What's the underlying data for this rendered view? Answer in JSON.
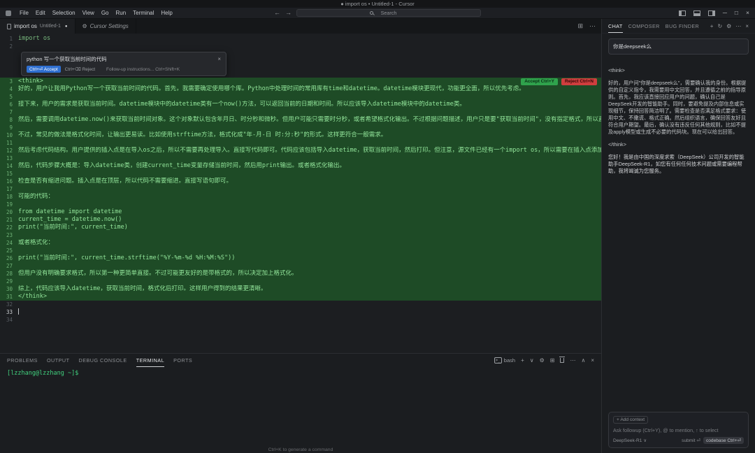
{
  "icons": {
    "back": "←",
    "forward": "→",
    "minimize": "─",
    "maximize": "□",
    "close": "×",
    "split": "⊞",
    "more": "⋯",
    "gear": "⚙",
    "plus": "+",
    "history": "↻",
    "chevron_down": "∨",
    "chevron_up": "∧",
    "modified_dot": "●",
    "bash_glyph": ">_",
    "model_chevron": "∨"
  },
  "titlebar": {
    "title": "● import os • Untitled-1 - Cursor"
  },
  "menubar": {
    "menus": [
      "File",
      "Edit",
      "Selection",
      "View",
      "Go",
      "Run",
      "Terminal",
      "Help"
    ],
    "search_placeholder": "Search"
  },
  "tabs": {
    "file_tab": {
      "label": "import os",
      "description": "Untitled-1"
    },
    "settings_tab": {
      "label": "Cursor Settings"
    }
  },
  "inline_prompt": {
    "prompt": "python 写一个获取当前时间的代码",
    "accept": "Ctrl+⏎ Accept",
    "reject": "Ctrl+⌫ Reject",
    "followup": "Follow-up instructions... Ctrl+Shift+K"
  },
  "diff_actions": {
    "accept": "Accept Ctrl+Y",
    "reject": "Reject Ctrl+N"
  },
  "editor": {
    "lines_top": [
      {
        "n": "1",
        "t": "import os",
        "cls": "py"
      },
      {
        "n": "2",
        "t": ""
      }
    ],
    "lines_diff": [
      {
        "n": "3",
        "t": "<think>",
        "cls": "diff"
      },
      {
        "n": "4",
        "t": "好的，用户让我用Python写一个获取当前时间的代码。首先，我需要确定使用哪个库。Python中处理时间的常用库有time和datetime。datetime模块更现代，功能更全面，所以优先考虑。",
        "cls": "diff"
      },
      {
        "n": "5",
        "t": "",
        "cls": "diff"
      },
      {
        "n": "6",
        "t": "接下来，用户的需求是获取当前时间。datetime模块中的datetime类有一个now()方法，可以返回当前的日期和时间。所以应该导入datetime模块中的datetime类。",
        "cls": "diff"
      },
      {
        "n": "7",
        "t": "",
        "cls": "diff"
      },
      {
        "n": "8",
        "t": "然后，需要调用datetime.now()来获取当前时间对象。这个对象默认包含年月日、时分秒和微秒。但用户可能只需要时分秒，或者希望格式化输出。不过根据问题描述，用户只是要\"获取当前时间\"，没有指定格式，所以直接打印完整的时间。",
        "cls": "diff"
      },
      {
        "n": "9",
        "t": "",
        "cls": "diff"
      },
      {
        "n": "10",
        "t": "不过，常见的做法是格式化时间，让输出更易读。比如使用strftime方法，格式化成\"年-月-日 时:分:秒\"的形式。这样更符合一般需求。",
        "cls": "diff"
      },
      {
        "n": "11",
        "t": "",
        "cls": "diff"
      },
      {
        "n": "12",
        "t": "然后考虑代码结构。用户提供的插入点是在导入os之后，所以不需要再处理导入。直接写代码即可。代码应该包括导入datetime，获取当前时间，然后打印。但注意，源文件已经有一个import os，所以需要在插入点添加from datetime import datetime。",
        "cls": "diff"
      },
      {
        "n": "13",
        "t": "",
        "cls": "diff"
      },
      {
        "n": "14",
        "t": "然后，代码步骤大概是：导入datetime类，创建current_time变量存储当前时间，然后用print输出。或者格式化输出。",
        "cls": "diff"
      },
      {
        "n": "15",
        "t": "",
        "cls": "diff"
      },
      {
        "n": "16",
        "t": "检查是否有缩进问题。插入点是在顶层，所以代码不需要缩进。直接写语句即可。",
        "cls": "diff"
      },
      {
        "n": "17",
        "t": "",
        "cls": "diff"
      },
      {
        "n": "18",
        "t": "可能的代码：",
        "cls": "diff"
      },
      {
        "n": "19",
        "t": "",
        "cls": "diff"
      },
      {
        "n": "20",
        "t": "from datetime import datetime",
        "cls": "diff"
      },
      {
        "n": "21",
        "t": "current_time = datetime.now()",
        "cls": "diff"
      },
      {
        "n": "22",
        "t": "print(\"当前时间:\", current_time)",
        "cls": "diff"
      },
      {
        "n": "23",
        "t": "",
        "cls": "diff"
      },
      {
        "n": "24",
        "t": "或者格式化：",
        "cls": "diff"
      },
      {
        "n": "25",
        "t": "",
        "cls": "diff"
      },
      {
        "n": "26",
        "t": "print(\"当前时间:\", current_time.strftime(\"%Y-%m-%d %H:%M:%S\"))",
        "cls": "diff"
      },
      {
        "n": "27",
        "t": "",
        "cls": "diff"
      },
      {
        "n": "28",
        "t": "但用户没有明确要求格式，所以第一种更简单直接。不过可能更友好的是带格式的，所以决定加上格式化。",
        "cls": "diff"
      },
      {
        "n": "29",
        "t": "",
        "cls": "diff"
      },
      {
        "n": "30",
        "t": "综上，代码应该导入datetime，获取当前时间，格式化后打印。这样用户得到的结果更清晰。",
        "cls": "diff"
      },
      {
        "n": "31",
        "t": "</think>",
        "cls": "diff"
      }
    ],
    "lines_bottom": [
      {
        "n": "32",
        "t": ""
      },
      {
        "n": "33",
        "t": "",
        "cls": "caret"
      },
      {
        "n": "34",
        "t": ""
      }
    ]
  },
  "panel": {
    "tabs": [
      {
        "label": "PROBLEMS"
      },
      {
        "label": "OUTPUT"
      },
      {
        "label": "DEBUG CONSOLE"
      },
      {
        "label": "TERMINAL",
        "cls": "active"
      },
      {
        "label": "PORTS"
      }
    ],
    "shell_label": "bash",
    "prompt": "[lzzhang@lzzhang ~]$",
    "hint": "Ctrl+K to generate a command"
  },
  "chat": {
    "tabs": [
      {
        "label": "CHAT",
        "cls": "active"
      },
      {
        "label": "COMPOSER"
      },
      {
        "label": "BUG FINDER"
      }
    ],
    "user_message": "你是deepseek么",
    "think_open": "<think>",
    "think_text": "好的，用户问\"你是deepseek么\"，需要确认我的身份。根据提供的自定义指令，我需要用中文回答，并且遵循之前的指导原则。首先，我应该直接回应用户的问题，确认自己是DeepSeek开发的智能助手。同时，要避免提及内部信息或实现细节，保持回答简洁明了。需要检查是否满足格式要求：使用中文、不撒谎、格式正确。然后组织语言，确保回答友好且符合用户期望。最后，确认没有违反任何其他规则，比如不提及apply模型或生成不必要的代码块。现在可以给出回答。",
    "think_close": "</think>",
    "answer": "您好！我是由中国的深度求索（DeepSeek）公司开发的智能助手DeepSeek-R1，如您有任何任何技术问题或需要编程帮助，我将竭诚为您服务。",
    "input": {
      "add_context": "+ Add context",
      "placeholder": "Ask followup (Ctrl+Y), @ to mention, ↑ to select",
      "model": "DeepSeek-R1",
      "submit": "submit ⏎",
      "codebase": "codebase Ctrl+⏎"
    }
  }
}
